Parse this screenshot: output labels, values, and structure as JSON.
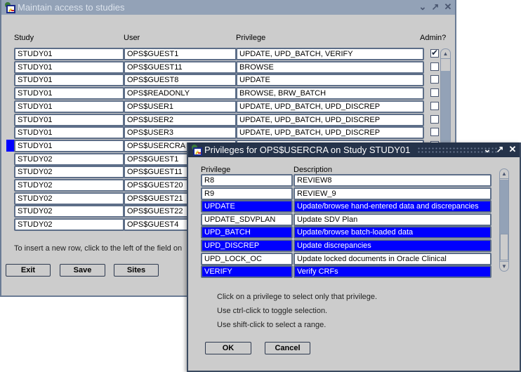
{
  "main_window": {
    "title": "Maintain access to studies",
    "controls": {
      "minimize": "⌄",
      "maximize": "↗",
      "close": "✕"
    },
    "columns": {
      "study": "Study",
      "user": "User",
      "privilege": "Privilege",
      "admin": "Admin?"
    },
    "rows": [
      {
        "study": "STUDY01",
        "user": "OPS$GUEST1",
        "privilege": "UPDATE, UPD_BATCH, VERIFY",
        "admin": true
      },
      {
        "study": "STUDY01",
        "user": "OPS$GUEST11",
        "privilege": "BROWSE",
        "admin": false
      },
      {
        "study": "STUDY01",
        "user": "OPS$GUEST8",
        "privilege": "UPDATE",
        "admin": false
      },
      {
        "study": "STUDY01",
        "user": "OPS$READONLY",
        "privilege": "BROWSE, BRW_BATCH",
        "admin": false
      },
      {
        "study": "STUDY01",
        "user": "OPS$USER1",
        "privilege": "UPDATE, UPD_BATCH, UPD_DISCREP",
        "admin": false
      },
      {
        "study": "STUDY01",
        "user": "OPS$USER2",
        "privilege": "UPDATE, UPD_BATCH, UPD_DISCREP",
        "admin": false
      },
      {
        "study": "STUDY01",
        "user": "OPS$USER3",
        "privilege": "UPDATE, UPD_BATCH, UPD_DISCREP",
        "admin": false
      },
      {
        "study": "STUDY01",
        "user": "OPS$USERCRA",
        "privilege": "",
        "admin": false,
        "current": true
      },
      {
        "study": "STUDY02",
        "user": "OPS$GUEST1",
        "privilege": "",
        "admin": false
      },
      {
        "study": "STUDY02",
        "user": "OPS$GUEST11",
        "privilege": "",
        "admin": false
      },
      {
        "study": "STUDY02",
        "user": "OPS$GUEST20",
        "privilege": "",
        "admin": false
      },
      {
        "study": "STUDY02",
        "user": "OPS$GUEST21",
        "privilege": "",
        "admin": false
      },
      {
        "study": "STUDY02",
        "user": "OPS$GUEST22",
        "privilege": "",
        "admin": false
      },
      {
        "study": "STUDY02",
        "user": "OPS$GUEST4",
        "privilege": "",
        "admin": false
      }
    ],
    "hint": "To insert a new row, click to the left of the field on",
    "buttons": {
      "exit": "Exit",
      "save": "Save",
      "sites": "Sites"
    }
  },
  "dialog": {
    "title": "Privileges for OPS$USERCRA on Study STUDY01",
    "controls": {
      "minimize": "⌄",
      "maximize": "↗",
      "close": "✕"
    },
    "columns": {
      "privilege": "Privilege",
      "description": "Description"
    },
    "rows": [
      {
        "privilege": "R8",
        "description": "REVIEW8",
        "selected": false
      },
      {
        "privilege": "R9",
        "description": "REVIEW_9",
        "selected": false
      },
      {
        "privilege": "UPDATE",
        "description": "Update/browse hand-entered data and discrepancies",
        "selected": true
      },
      {
        "privilege": "UPDATE_SDVPLAN",
        "description": "Update SDV Plan",
        "selected": false
      },
      {
        "privilege": "UPD_BATCH",
        "description": "Update/browse batch-loaded data",
        "selected": true
      },
      {
        "privilege": "UPD_DISCREP",
        "description": "Update discrepancies",
        "selected": true
      },
      {
        "privilege": "UPD_LOCK_OC",
        "description": "Update locked documents in Oracle Clinical",
        "selected": false
      },
      {
        "privilege": "VERIFY",
        "description": "Verify CRFs",
        "selected": true
      }
    ],
    "instructions": [
      "Click on a privilege to select only that privilege.",
      "Use ctrl-click to toggle selection.",
      "Use shift-click to select a range."
    ],
    "buttons": {
      "ok": "OK",
      "cancel": "Cancel"
    }
  },
  "colors": {
    "selection": "#0000ff",
    "titlebar_inactive": "#93a2b7",
    "titlebar_active": "#25334a",
    "window_bg": "#cccccc"
  }
}
